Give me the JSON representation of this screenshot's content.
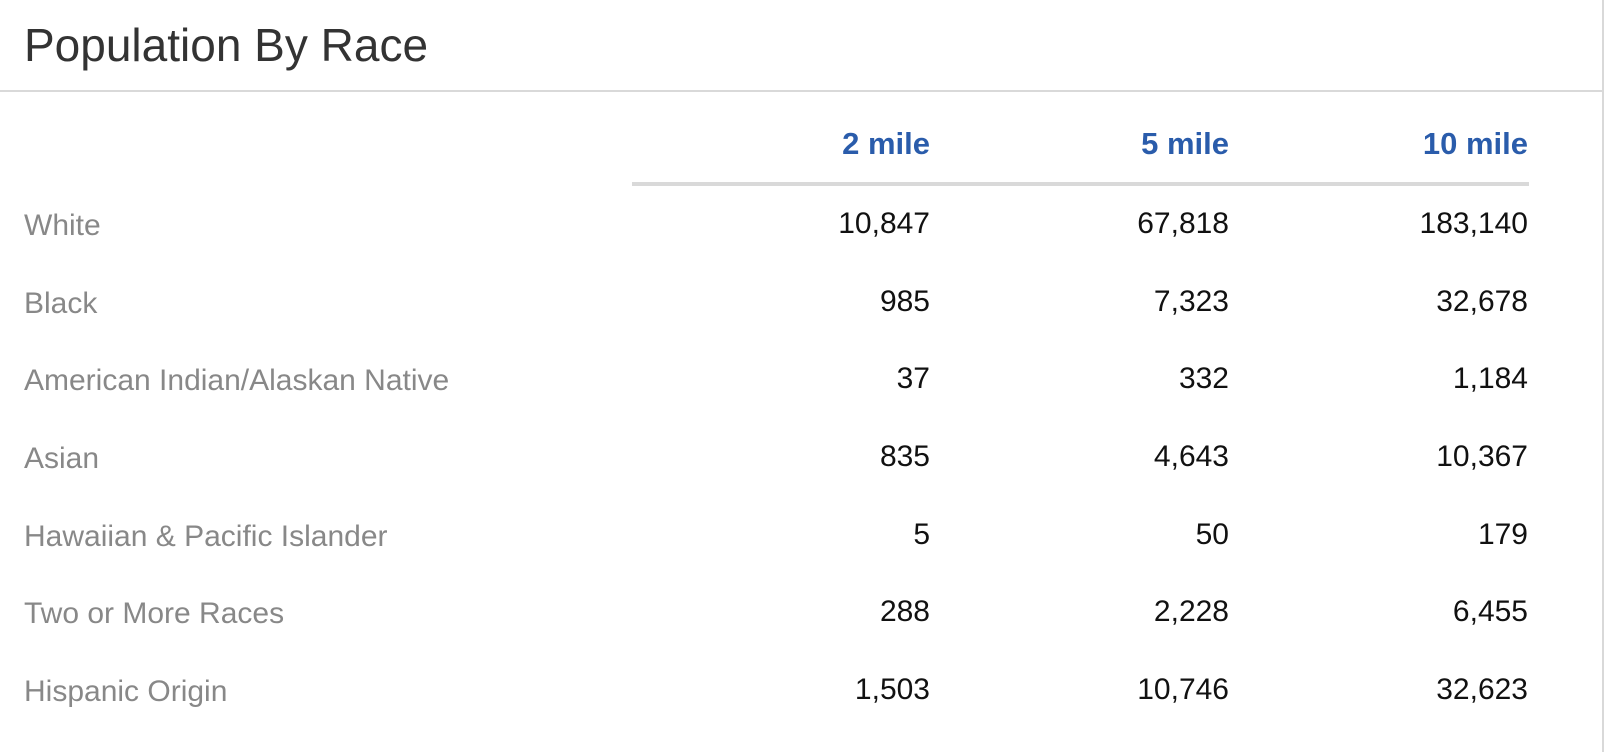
{
  "panel": {
    "title": "Population By Race"
  },
  "table": {
    "columns": [
      "2 mile",
      "5 mile",
      "10 mile"
    ],
    "rows": [
      {
        "label": "White",
        "values": [
          "10,847",
          "67,818",
          "183,140"
        ]
      },
      {
        "label": "Black",
        "values": [
          "985",
          "7,323",
          "32,678"
        ]
      },
      {
        "label": "American Indian/Alaskan Native",
        "values": [
          "37",
          "332",
          "1,184"
        ]
      },
      {
        "label": "Asian",
        "values": [
          "835",
          "4,643",
          "10,367"
        ]
      },
      {
        "label": "Hawaiian & Pacific Islander",
        "values": [
          "5",
          "50",
          "179"
        ]
      },
      {
        "label": "Two or More Races",
        "values": [
          "288",
          "2,228",
          "6,455"
        ]
      },
      {
        "label": "Hispanic Origin",
        "values": [
          "1,503",
          "10,746",
          "32,623"
        ]
      }
    ]
  },
  "colors": {
    "header_accent": "#2a5cab",
    "label_text": "#888888",
    "value_text": "#111111",
    "divider": "#d9d9d9"
  }
}
